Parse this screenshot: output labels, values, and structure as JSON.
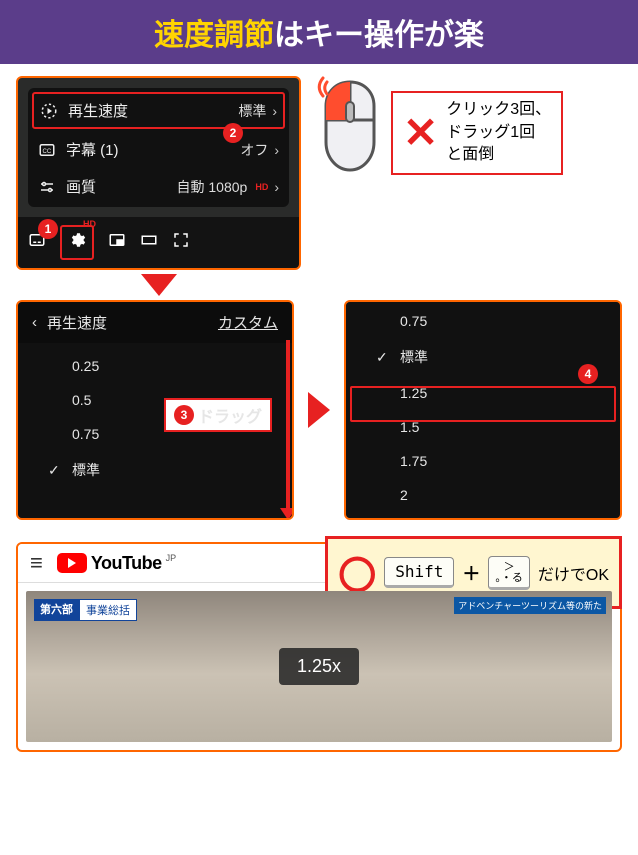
{
  "banner": {
    "highlight": "速度調節",
    "rest": "はキー操作が楽"
  },
  "settings_menu": {
    "items": [
      {
        "label": "再生速度",
        "value": "標準",
        "icon": "play-circle-icon",
        "highlighted": true
      },
      {
        "label": "字幕 (1)",
        "value": "オフ",
        "icon": "cc-icon"
      },
      {
        "label": "画質",
        "value": "自動 1080p",
        "valueBadge": "HD",
        "icon": "sliders-icon"
      }
    ],
    "badges": {
      "step1": "1",
      "step2": "2"
    },
    "gearHd": "HD"
  },
  "x_callout": {
    "text": "クリック3回、\nドラッグ1回\nと面倒"
  },
  "speed_left": {
    "title": "再生速度",
    "custom": "カスタム",
    "options": [
      "0.25",
      "0.5",
      "0.75",
      "標準"
    ],
    "selected": "標準",
    "drag_badge": "3",
    "drag_text": "ドラッグ"
  },
  "speed_right": {
    "options": [
      "0.75",
      "標準",
      "1.25",
      "1.5",
      "1.75",
      "2"
    ],
    "selected": "標準",
    "highlighted": "1.25",
    "badge": "4"
  },
  "ok_callout": {
    "shift_key": "Shift",
    "plus": "＋",
    "period_key_top": "＞",
    "period_key_bot": "。・る",
    "text": "だけでOK"
  },
  "yt": {
    "brand": "YouTube",
    "region": "JP",
    "chapter_prefix": "第六部",
    "chapter_title": "事業総括",
    "ribbon": "アドベンチャーツーリズム等の新た",
    "speed_pill": "1.25x"
  }
}
